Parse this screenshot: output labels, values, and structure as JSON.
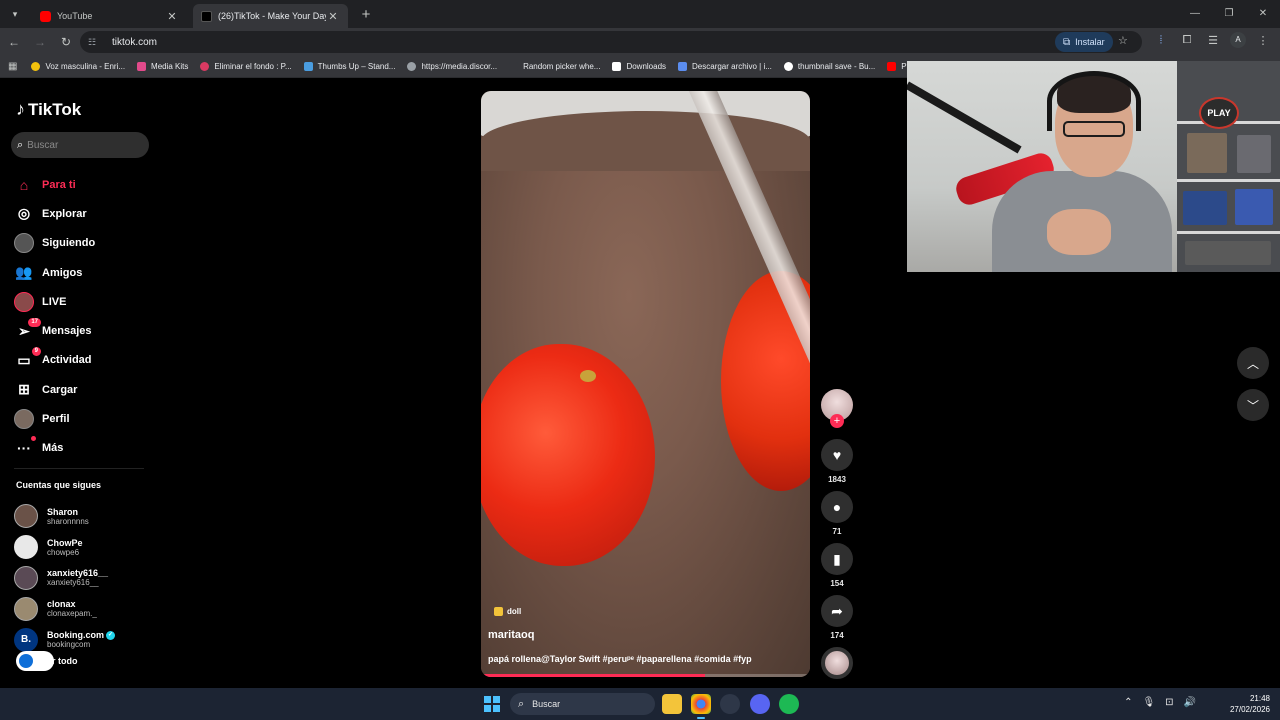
{
  "browser": {
    "tabs": [
      {
        "title": "YouTube",
        "active": false,
        "favicon": "youtube-icon"
      },
      {
        "title": "(26)TikTok - Make Your Day",
        "active": true,
        "favicon": "tiktok-icon"
      }
    ],
    "url": "tiktok.com",
    "install_label": "Instalar",
    "bookmarks": [
      {
        "label": "Voz masculina - Enri...",
        "color": "#f4c20d"
      },
      {
        "label": "Media Kits",
        "color": "#e24a8b"
      },
      {
        "label": "Eliminar el fondo : P...",
        "color": "#d93a62"
      },
      {
        "label": "Thumbs Up – Stand...",
        "color": "#4a9de0"
      },
      {
        "label": "https://media.discor...",
        "color": "#9aa0a6"
      },
      {
        "label": "Random picker whe...",
        "color": "#35363a"
      },
      {
        "label": "Downloads",
        "color": "#ffffff"
      },
      {
        "label": "Descargar archivo | i...",
        "color": "#5b8def"
      },
      {
        "label": "thumbnail save - Bu...",
        "color": "#ffffff"
      },
      {
        "label": "Pa",
        "color": "#ff0000"
      }
    ],
    "profile_initial": "A"
  },
  "tiktok": {
    "logo_text": "TikTok",
    "search_placeholder": "Buscar",
    "nav": [
      {
        "label": "Para ti",
        "icon": "home-icon",
        "active": true
      },
      {
        "label": "Explorar",
        "icon": "compass-icon"
      },
      {
        "label": "Siguiendo",
        "icon": "following-avatar-icon"
      },
      {
        "label": "Amigos",
        "icon": "friends-icon"
      },
      {
        "label": "LIVE",
        "icon": "live-avatar-icon"
      },
      {
        "label": "Mensajes",
        "icon": "messages-icon",
        "badge": "17"
      },
      {
        "label": "Actividad",
        "icon": "activity-icon",
        "badge": "9"
      },
      {
        "label": "Cargar",
        "icon": "upload-icon"
      },
      {
        "label": "Perfil",
        "icon": "profile-avatar-icon"
      },
      {
        "label": "Más",
        "icon": "more-icon",
        "dot": true
      }
    ],
    "following_title": "Cuentas que sigues",
    "following": [
      {
        "name": "Sharon",
        "handle": "sharonnnns"
      },
      {
        "name": "ChowPe",
        "handle": "chowpe6"
      },
      {
        "name": "xanxiety616__",
        "handle": "xanxiety616__"
      },
      {
        "name": "clonax",
        "handle": "clonaxepam._"
      },
      {
        "name": "Booking.com",
        "handle": "bookingcom",
        "verified": true
      }
    ],
    "see_all": "Ver todo",
    "see_all_visible": "er todo"
  },
  "video": {
    "sound": "doll",
    "username": "maritaoq",
    "description": "papá rollena@Taylor Swift #peruᵖᵉ #paparellena #comida #fyp",
    "progress": 0.68,
    "likes": "1843",
    "comments": "71",
    "saves": "154",
    "shares": "174"
  },
  "taskbar": {
    "search_placeholder": "Buscar",
    "time": "21:48",
    "date": "27/02/2026"
  },
  "colors": {
    "accent": "#fe2c55",
    "verified": "#20d5ec",
    "taskbar": "#1c2433"
  }
}
